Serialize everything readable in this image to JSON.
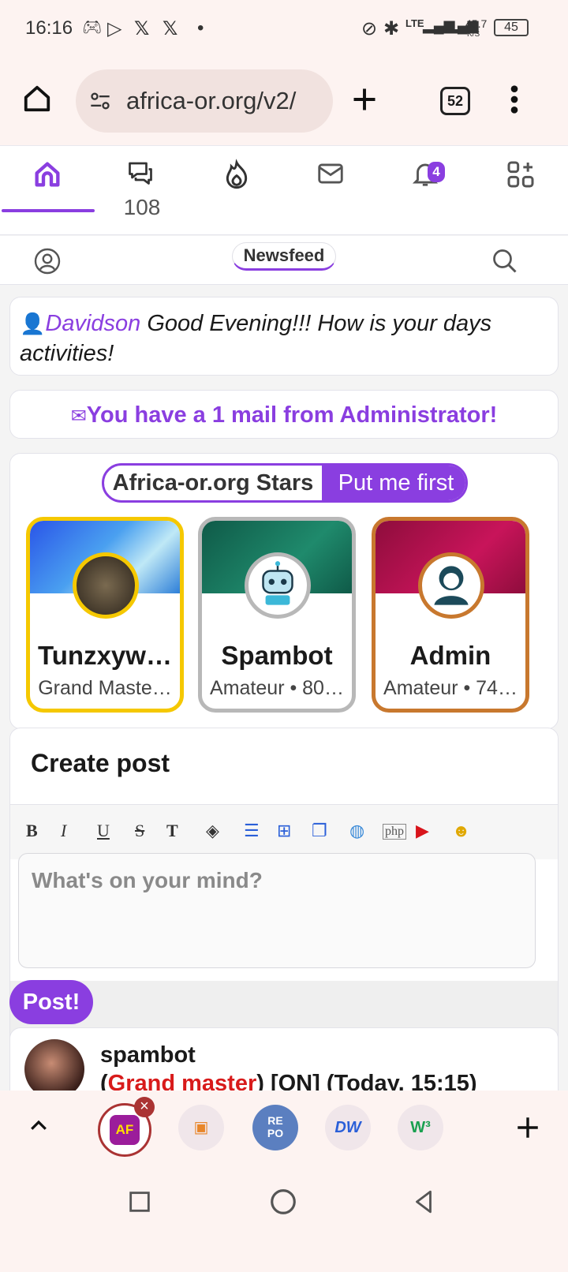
{
  "status_bar": {
    "time": "16:16",
    "speed": "45.7",
    "speed_unit": "K/S",
    "battery": "45",
    "net": "LTE"
  },
  "browser": {
    "url": "africa-or.org/v2/",
    "tab_count": "52"
  },
  "top_nav": {
    "messages_count": "108",
    "notifications_badge": "4"
  },
  "sub_nav": {
    "active_tab": "Newsfeed"
  },
  "greeting": {
    "name": "Davidson",
    "message": " Good Evening!!! How is your days activities!"
  },
  "mail_notice": {
    "text": "You have a 1 mail from Administrator!"
  },
  "stars": {
    "title": "Africa-or.org Stars",
    "cta": "Put me first",
    "members": [
      {
        "name": "Tunzxyw…",
        "rank": "Grand Maste…",
        "border_color": "#f5c800"
      },
      {
        "name": "Spambot",
        "rank": "Amateur • 80…",
        "border_color": "#b8b8b8"
      },
      {
        "name": "Admin",
        "rank": "Amateur • 74…",
        "border_color": "#c8782e"
      }
    ]
  },
  "create_post": {
    "title": "Create post",
    "placeholder": "What's on your mind?",
    "submit": "Post!",
    "toolbar": [
      "bold-icon",
      "italic-icon",
      "underline-icon",
      "strikethrough-icon",
      "text-color-icon",
      "fill-color-icon",
      "list-icon",
      "add-box-icon",
      "copy-icon",
      "globe-icon",
      "php-icon",
      "youtube-icon",
      "emoji-icon"
    ]
  },
  "post": {
    "user": "spambot",
    "rank": "Grand master",
    "status": "[ON]",
    "time": "(Today, 15:15)"
  },
  "colors": {
    "accent": "#8a3ee0",
    "rank_red": "#d81b1b"
  }
}
